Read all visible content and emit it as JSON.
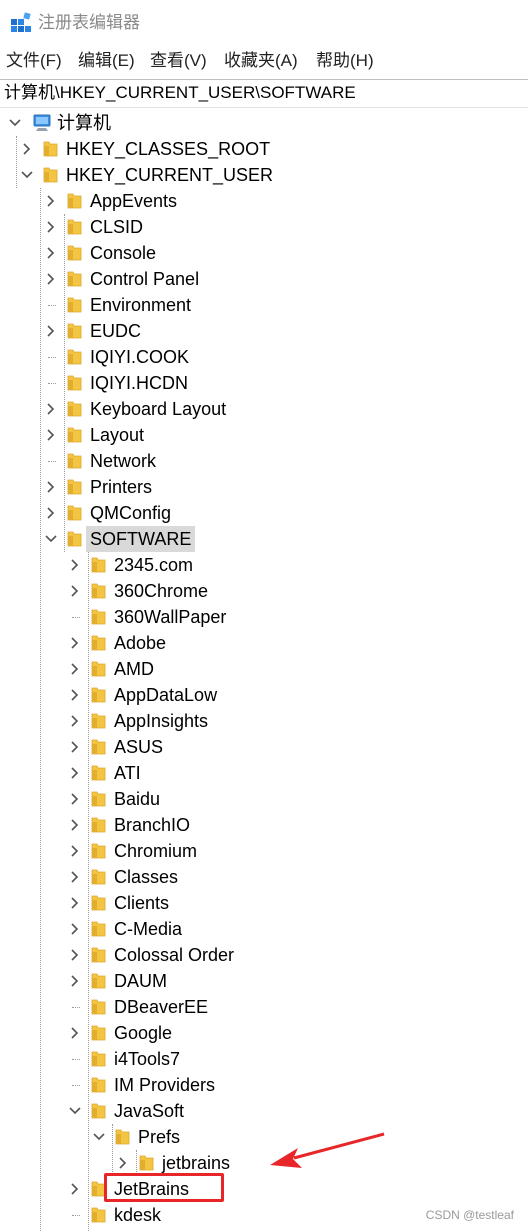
{
  "window": {
    "title": "注册表编辑器"
  },
  "menu": [
    "文件(F)",
    "编辑(E)",
    "查看(V)",
    "收藏夹(A)",
    "帮助(H)"
  ],
  "address": "计算机\\HKEY_CURRENT_USER\\SOFTWARE",
  "tree": {
    "root": "计算机",
    "nodes": [
      {
        "label": "HKEY_CLASSES_ROOT",
        "depth": 1,
        "chev": "right"
      },
      {
        "label": "HKEY_CURRENT_USER",
        "depth": 1,
        "chev": "down"
      },
      {
        "label": "AppEvents",
        "depth": 2,
        "chev": "right"
      },
      {
        "label": "CLSID",
        "depth": 2,
        "chev": "right"
      },
      {
        "label": "Console",
        "depth": 2,
        "chev": "right"
      },
      {
        "label": "Control Panel",
        "depth": 2,
        "chev": "right"
      },
      {
        "label": "Environment",
        "depth": 2,
        "chev": "none"
      },
      {
        "label": "EUDC",
        "depth": 2,
        "chev": "right"
      },
      {
        "label": "IQIYI.COOK",
        "depth": 2,
        "chev": "none"
      },
      {
        "label": "IQIYI.HCDN",
        "depth": 2,
        "chev": "none"
      },
      {
        "label": "Keyboard Layout",
        "depth": 2,
        "chev": "right"
      },
      {
        "label": "Layout",
        "depth": 2,
        "chev": "right"
      },
      {
        "label": "Network",
        "depth": 2,
        "chev": "none"
      },
      {
        "label": "Printers",
        "depth": 2,
        "chev": "right"
      },
      {
        "label": "QMConfig",
        "depth": 2,
        "chev": "right"
      },
      {
        "label": "SOFTWARE",
        "depth": 2,
        "chev": "down",
        "selected": true
      },
      {
        "label": "2345.com",
        "depth": 3,
        "chev": "right"
      },
      {
        "label": "360Chrome",
        "depth": 3,
        "chev": "right"
      },
      {
        "label": "360WallPaper",
        "depth": 3,
        "chev": "none"
      },
      {
        "label": "Adobe",
        "depth": 3,
        "chev": "right"
      },
      {
        "label": "AMD",
        "depth": 3,
        "chev": "right"
      },
      {
        "label": "AppDataLow",
        "depth": 3,
        "chev": "right"
      },
      {
        "label": "AppInsights",
        "depth": 3,
        "chev": "right"
      },
      {
        "label": "ASUS",
        "depth": 3,
        "chev": "right"
      },
      {
        "label": "ATI",
        "depth": 3,
        "chev": "right"
      },
      {
        "label": "Baidu",
        "depth": 3,
        "chev": "right"
      },
      {
        "label": "BranchIO",
        "depth": 3,
        "chev": "right"
      },
      {
        "label": "Chromium",
        "depth": 3,
        "chev": "right"
      },
      {
        "label": "Classes",
        "depth": 3,
        "chev": "right"
      },
      {
        "label": "Clients",
        "depth": 3,
        "chev": "right"
      },
      {
        "label": "C-Media",
        "depth": 3,
        "chev": "right"
      },
      {
        "label": "Colossal Order",
        "depth": 3,
        "chev": "right"
      },
      {
        "label": "DAUM",
        "depth": 3,
        "chev": "right"
      },
      {
        "label": "DBeaverEE",
        "depth": 3,
        "chev": "none"
      },
      {
        "label": "Google",
        "depth": 3,
        "chev": "right"
      },
      {
        "label": "i4Tools7",
        "depth": 3,
        "chev": "none"
      },
      {
        "label": "IM Providers",
        "depth": 3,
        "chev": "none"
      },
      {
        "label": "JavaSoft",
        "depth": 3,
        "chev": "down"
      },
      {
        "label": "Prefs",
        "depth": 4,
        "chev": "down"
      },
      {
        "label": "jetbrains",
        "depth": 5,
        "chev": "right"
      },
      {
        "label": "JetBrains",
        "depth": 3,
        "chev": "right"
      },
      {
        "label": "kdesk",
        "depth": 3,
        "chev": "none"
      }
    ]
  },
  "annotation": {
    "box_color": "#e8262a",
    "arrow_color": "#e8262a"
  },
  "watermark": "CSDN @testleaf",
  "colors": {
    "folder": "#f4c542",
    "folder_dark": "#dba72b",
    "selected_bg": "#d9d9d9",
    "chevron": "#555555"
  }
}
